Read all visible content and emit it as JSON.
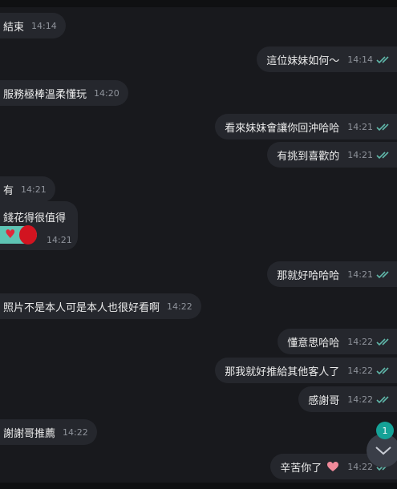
{
  "colors": {
    "background": "#18191d",
    "bubble": "#25272d",
    "tick": "#5fb7a9",
    "badge": "#15a297"
  },
  "messages": [
    {
      "text": "結束",
      "time": "14:14",
      "dir": "in"
    },
    {
      "text": "這位妹妹如何～",
      "time": "14:14",
      "dir": "out"
    },
    {
      "text": "服務極棒溫柔懂玩",
      "time": "14:20",
      "dir": "in"
    },
    {
      "text": "看來妹妹會讓你回沖哈哈",
      "time": "14:21",
      "dir": "out"
    },
    {
      "text": "有挑到喜歡的",
      "time": "14:21",
      "dir": "out"
    },
    {
      "text": "有",
      "time": "14:21",
      "dir": "in"
    },
    {
      "text": "錢花得很值得",
      "time": "14:21",
      "dir": "in",
      "reaction": "heart-icon"
    },
    {
      "text": "那就好哈哈哈",
      "time": "14:21",
      "dir": "out"
    },
    {
      "text": "照片不是本人可是本人也很好看啊",
      "time": "14:22",
      "dir": "in"
    },
    {
      "text": "懂意思哈哈",
      "time": "14:22",
      "dir": "out"
    },
    {
      "text": "那我就好推給其他客人了",
      "time": "14:22",
      "dir": "out"
    },
    {
      "text": "感謝哥",
      "time": "14:22",
      "dir": "out"
    },
    {
      "text": "謝謝哥推薦",
      "time": "14:22",
      "dir": "in"
    },
    {
      "text": "辛苦你了",
      "time": "14:22",
      "dir": "out",
      "emoji": "heart-hands-icon"
    }
  ],
  "scroll": {
    "unread_count": "1",
    "icon": "chevron-down-icon"
  }
}
